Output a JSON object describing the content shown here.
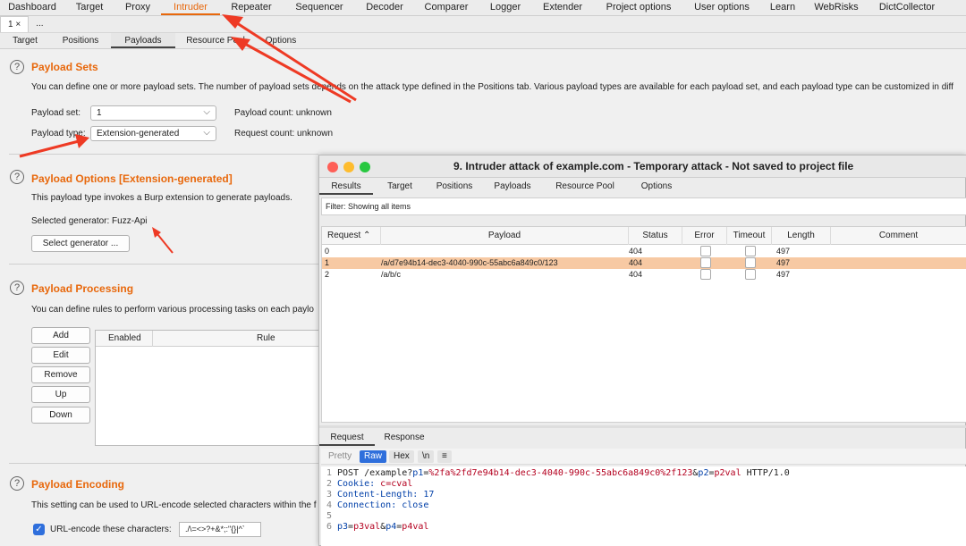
{
  "topnav": [
    "Dashboard",
    "Target",
    "Proxy",
    "Intruder",
    "Repeater",
    "Sequencer",
    "Decoder",
    "Comparer",
    "Logger",
    "Extender",
    "Project options",
    "User options",
    "Learn",
    "WebRisks",
    "DictCollector"
  ],
  "subtabs": {
    "tab1": "1 ×",
    "tab2": "..."
  },
  "intruder_tabs": [
    "Target",
    "Positions",
    "Payloads",
    "Resource Pool",
    "Options"
  ],
  "payload_sets": {
    "title": "Payload Sets",
    "desc": "You can define one or more payload sets. The number of payload sets depends on the attack type defined in the Positions tab. Various payload types are available for each payload set, and each payload type can be customized in diff",
    "set_label": "Payload set:",
    "set_value": "1",
    "type_label": "Payload type:",
    "type_value": "Extension-generated",
    "count_label": "Payload count:  unknown",
    "request_label": "Request count:  unknown"
  },
  "payload_options": {
    "title": "Payload Options [Extension-generated]",
    "desc": "This payload type invokes a Burp extension to generate payloads.",
    "selected_generator": "Selected generator:  Fuzz-Api",
    "button": "Select generator ..."
  },
  "payload_processing": {
    "title": "Payload Processing",
    "desc": "You can define rules to perform various processing tasks on each paylo",
    "buttons": [
      "Add",
      "Edit",
      "Remove",
      "Up",
      "Down"
    ],
    "col_enabled": "Enabled",
    "col_rule": "Rule"
  },
  "payload_encoding": {
    "title": "Payload Encoding",
    "desc": "This setting can be used to URL-encode selected characters within the f",
    "checkbox_label": "URL-encode these characters:",
    "chars": "./\\=<>?+&*;:\"{}|^`"
  },
  "attack_window": {
    "title": "9. Intruder attack of example.com - Temporary attack - Not saved to project file",
    "tabs": [
      "Results",
      "Target",
      "Positions",
      "Payloads",
      "Resource Pool",
      "Options"
    ],
    "filter": "Filter: Showing all items",
    "columns": [
      "Request ⌃",
      "Payload",
      "Status",
      "Error",
      "Timeout",
      "Length",
      "Comment"
    ],
    "rows": [
      {
        "request": "0",
        "payload": "",
        "status": "404",
        "length": "497"
      },
      {
        "request": "1",
        "payload": "/a/d7e94b14-dec3-4040-990c-55abc6a849c0/123",
        "status": "404",
        "length": "497"
      },
      {
        "request": "2",
        "payload": "/a/b/c",
        "status": "404",
        "length": "497"
      }
    ],
    "bottom_tabs": [
      "Request",
      "Response"
    ],
    "view_buttons": [
      "Pretty",
      "Raw",
      "Hex",
      "\\n",
      "≡"
    ],
    "request_lines": {
      "l1_a": "POST /example?",
      "l1_b": "p1",
      "l1_c": "=",
      "l1_d": "%2fa%2fd7e94b14-dec3-4040-990c-55abc6a849c0%2f123",
      "l1_e": "&",
      "l1_f": "p2",
      "l1_g": "=",
      "l1_h": "p2val",
      "l1_i": " HTTP/1.0",
      "l2_k": "Cookie: ",
      "l2_v": "c=cval",
      "l3": "Content-Length: 17",
      "l4": "Connection: close",
      "l6_a": "p3",
      "l6_b": "=",
      "l6_c": "p3val",
      "l6_d": "&",
      "l6_e": "p4",
      "l6_f": "=",
      "l6_g": "p4val"
    },
    "line_numbers": [
      "1",
      "2",
      "3",
      "4",
      "5",
      "6"
    ]
  },
  "colors": {
    "accent": "#e8680c",
    "selected_row": "#f7c9a3",
    "annotation": "#ee3a24"
  }
}
